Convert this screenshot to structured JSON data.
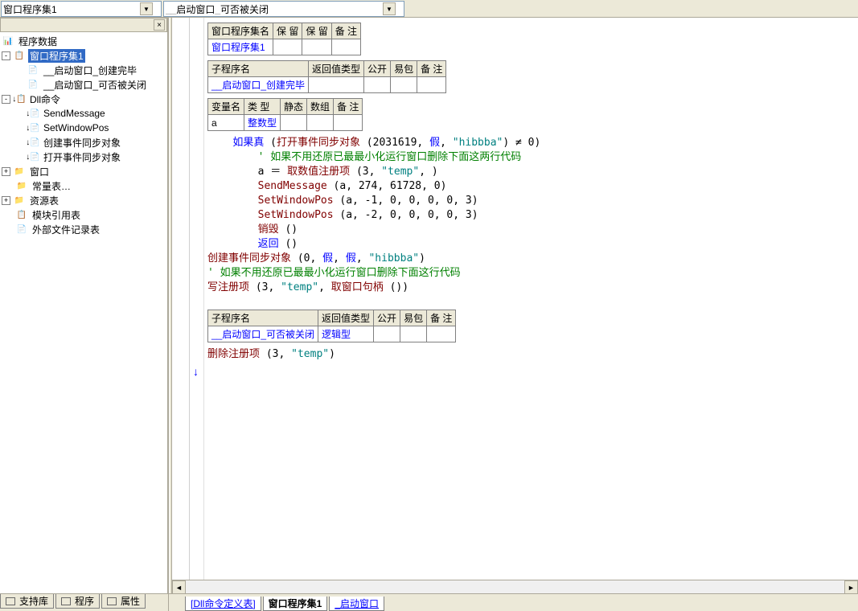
{
  "topbar": {
    "combo1": "窗口程序集1",
    "combo2": "__启动窗口_可否被关闭"
  },
  "tree": {
    "title": "程序数据",
    "nodes": [
      {
        "depth": 0,
        "exp": "-",
        "ico": "📋",
        "label": "窗口程序集1",
        "sel": true
      },
      {
        "depth": 1,
        "exp": "",
        "ico": "📄",
        "label": "__启动窗口_创建完毕"
      },
      {
        "depth": 1,
        "exp": "",
        "ico": "📄",
        "label": "__启动窗口_可否被关闭"
      },
      {
        "depth": 0,
        "exp": "-",
        "ico": "↓📋",
        "label": "Dll命令"
      },
      {
        "depth": 1,
        "exp": "",
        "ico": "↓📄",
        "label": "SendMessage"
      },
      {
        "depth": 1,
        "exp": "",
        "ico": "↓📄",
        "label": "SetWindowPos"
      },
      {
        "depth": 1,
        "exp": "",
        "ico": "↓📄",
        "label": "创建事件同步对象"
      },
      {
        "depth": 1,
        "exp": "",
        "ico": "↓📄",
        "label": "打开事件同步对象"
      },
      {
        "depth": 0,
        "exp": "+",
        "ico": "📁",
        "label": "窗口"
      },
      {
        "depth": 0,
        "exp": "",
        "ico": "📁",
        "label": "常量表…"
      },
      {
        "depth": 0,
        "exp": "+",
        "ico": "📁",
        "label": "资源表"
      },
      {
        "depth": 0,
        "exp": "",
        "ico": "📋",
        "label": "模块引用表"
      },
      {
        "depth": 0,
        "exp": "",
        "ico": "📄",
        "label": "外部文件记录表"
      }
    ]
  },
  "tables": {
    "t1": {
      "headers": [
        "窗口程序集名",
        "保 留",
        "保 留",
        "备 注"
      ],
      "row": [
        "窗口程序集1",
        "",
        "",
        ""
      ]
    },
    "t2": {
      "headers": [
        "子程序名",
        "返回值类型",
        "公开",
        "易包",
        "备 注"
      ],
      "row": [
        "__启动窗口_创建完毕",
        "",
        "",
        "",
        ""
      ]
    },
    "t3": {
      "headers": [
        "变量名",
        "类 型",
        "静态",
        "数组",
        "备 注"
      ],
      "row": [
        "a",
        "整数型",
        "",
        "",
        ""
      ]
    },
    "t4": {
      "headers": [
        "子程序名",
        "返回值类型",
        "公开",
        "易包",
        "备 注"
      ],
      "row": [
        "__启动窗口_可否被关闭",
        "逻辑型",
        "",
        "",
        ""
      ]
    }
  },
  "code1": [
    {
      "indent": 1,
      "parts": [
        {
          "t": "如果真 ",
          "c": "c-blue"
        },
        {
          "t": "(",
          "c": "c-black"
        },
        {
          "t": "打开事件同步对象 ",
          "c": "c-red"
        },
        {
          "t": "(2031619, ",
          "c": "c-black"
        },
        {
          "t": "假",
          "c": "c-blue"
        },
        {
          "t": ", ",
          "c": "c-black"
        },
        {
          "t": "\"hibbba\"",
          "c": "c-teal"
        },
        {
          "t": ") ≠ 0)",
          "c": "c-black"
        }
      ]
    },
    {
      "indent": 2,
      "parts": [
        {
          "t": "' 如果不用还原已最最小化运行窗口删除下面这两行代码",
          "c": "c-green"
        }
      ]
    },
    {
      "indent": 2,
      "parts": [
        {
          "t": "a ",
          "c": "c-black"
        },
        {
          "t": "＝ ",
          "c": "c-black"
        },
        {
          "t": "取数值注册项 ",
          "c": "c-red"
        },
        {
          "t": "(3, ",
          "c": "c-black"
        },
        {
          "t": "\"temp\"",
          "c": "c-teal"
        },
        {
          "t": ", )",
          "c": "c-black"
        }
      ]
    },
    {
      "indent": 2,
      "parts": [
        {
          "t": "SendMessage ",
          "c": "c-red"
        },
        {
          "t": "(a, 274, 61728, 0)",
          "c": "c-black"
        }
      ]
    },
    {
      "indent": 2,
      "parts": [
        {
          "t": "SetWindowPos ",
          "c": "c-red"
        },
        {
          "t": "(a, -1, 0, 0, 0, 0, 3)",
          "c": "c-black"
        }
      ]
    },
    {
      "indent": 2,
      "parts": [
        {
          "t": "SetWindowPos ",
          "c": "c-red"
        },
        {
          "t": "(a, -2, 0, 0, 0, 0, 3)",
          "c": "c-black"
        }
      ]
    },
    {
      "indent": 2,
      "parts": [
        {
          "t": "销毁 ",
          "c": "c-red"
        },
        {
          "t": "()",
          "c": "c-black"
        }
      ]
    },
    {
      "indent": 2,
      "parts": [
        {
          "t": "返回 ",
          "c": "c-blue"
        },
        {
          "t": "()",
          "c": "c-black"
        }
      ]
    },
    {
      "indent": 0,
      "parts": [
        {
          "t": "创建事件同步对象 ",
          "c": "c-red"
        },
        {
          "t": "(0, ",
          "c": "c-black"
        },
        {
          "t": "假",
          "c": "c-blue"
        },
        {
          "t": ", ",
          "c": "c-black"
        },
        {
          "t": "假",
          "c": "c-blue"
        },
        {
          "t": ", ",
          "c": "c-black"
        },
        {
          "t": "\"hibbba\"",
          "c": "c-teal"
        },
        {
          "t": ")",
          "c": "c-black"
        }
      ]
    },
    {
      "indent": 0,
      "parts": [
        {
          "t": "' 如果不用还原已最最小化运行窗口删除下面这行代码",
          "c": "c-green"
        }
      ]
    },
    {
      "indent": 0,
      "parts": [
        {
          "t": "写注册项 ",
          "c": "c-red"
        },
        {
          "t": "(3, ",
          "c": "c-black"
        },
        {
          "t": "\"temp\"",
          "c": "c-teal"
        },
        {
          "t": ", ",
          "c": "c-black"
        },
        {
          "t": "取窗口句柄 ",
          "c": "c-red"
        },
        {
          "t": "())",
          "c": "c-black"
        }
      ]
    }
  ],
  "code2": [
    {
      "indent": 0,
      "parts": [
        {
          "t": "删除注册项 ",
          "c": "c-red"
        },
        {
          "t": "(3, ",
          "c": "c-black"
        },
        {
          "t": "\"temp\"",
          "c": "c-teal"
        },
        {
          "t": ")",
          "c": "c-black"
        }
      ]
    }
  ],
  "bottomTabs": {
    "left": [
      {
        "label": "支持库"
      },
      {
        "label": "程序"
      },
      {
        "label": "属性"
      }
    ],
    "right": [
      {
        "label": "[Dll命令定义表]",
        "cls": "link"
      },
      {
        "label": "窗口程序集1",
        "cls": "active"
      },
      {
        "label": "_启动窗口",
        "cls": "link"
      }
    ]
  }
}
